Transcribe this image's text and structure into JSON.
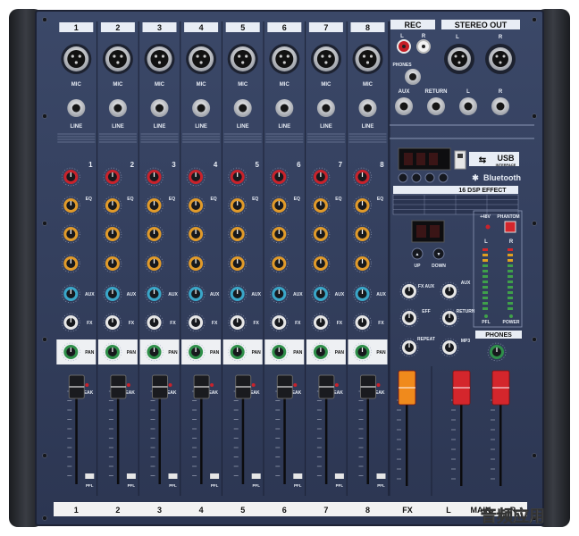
{
  "channels": [
    {
      "number": "1",
      "fader_label": "1"
    },
    {
      "number": "2",
      "fader_label": "2"
    },
    {
      "number": "3",
      "fader_label": "3"
    },
    {
      "number": "4",
      "fader_label": "4"
    },
    {
      "number": "5",
      "fader_label": "5"
    },
    {
      "number": "6",
      "fader_label": "6"
    },
    {
      "number": "7",
      "fader_label": "7"
    },
    {
      "number": "8",
      "fader_label": "8"
    }
  ],
  "input_labels": {
    "mic": "MIC",
    "line": "LINE"
  },
  "knob_labels": {
    "eq": "EQ",
    "aux": "AUX",
    "fx": "FX",
    "pan": "PAN",
    "peak": "PEAK",
    "pfl": "PFL"
  },
  "rec": {
    "title": "REC",
    "l": "L",
    "r": "R"
  },
  "stereo_out": {
    "title": "STEREO OUT",
    "l": "L",
    "r": "R"
  },
  "master_inputs": {
    "phones": "PHONES",
    "aux": "AUX",
    "return": "RETURN",
    "l": "L",
    "r": "R"
  },
  "usb": {
    "label": "USB",
    "sub": "INTERFACE"
  },
  "bluetooth": {
    "label": "Bluetooth"
  },
  "dsp": {
    "title": "16 DSP EFFECT",
    "up": "UP",
    "down": "DOWN"
  },
  "master_knobs": {
    "fx_aux": "FX AUX",
    "eff": "EFF",
    "repeat": "REPEAT",
    "aux": "AUX",
    "return": "RETURN",
    "mp3": "MP3"
  },
  "power": {
    "phantom": "PHANTOM",
    "v48": "+48V",
    "pfl": "PFL",
    "power": "POWER",
    "l": "L",
    "r": "R"
  },
  "phones_label": "PHONES",
  "fader_strip": {
    "fx": "FX",
    "l": "L",
    "main": "MAIN",
    "r": "R"
  },
  "watermark": "音频应用",
  "colors": {
    "panel": "#34405e",
    "knob_red": "#c8232c",
    "knob_orange": "#e09a2a",
    "knob_blue": "#3aa6c8",
    "knob_white": "#e6e6e6",
    "knob_green": "#2f8f4a",
    "fader_red": "#d4262c",
    "fader_orange": "#f08a1c"
  }
}
